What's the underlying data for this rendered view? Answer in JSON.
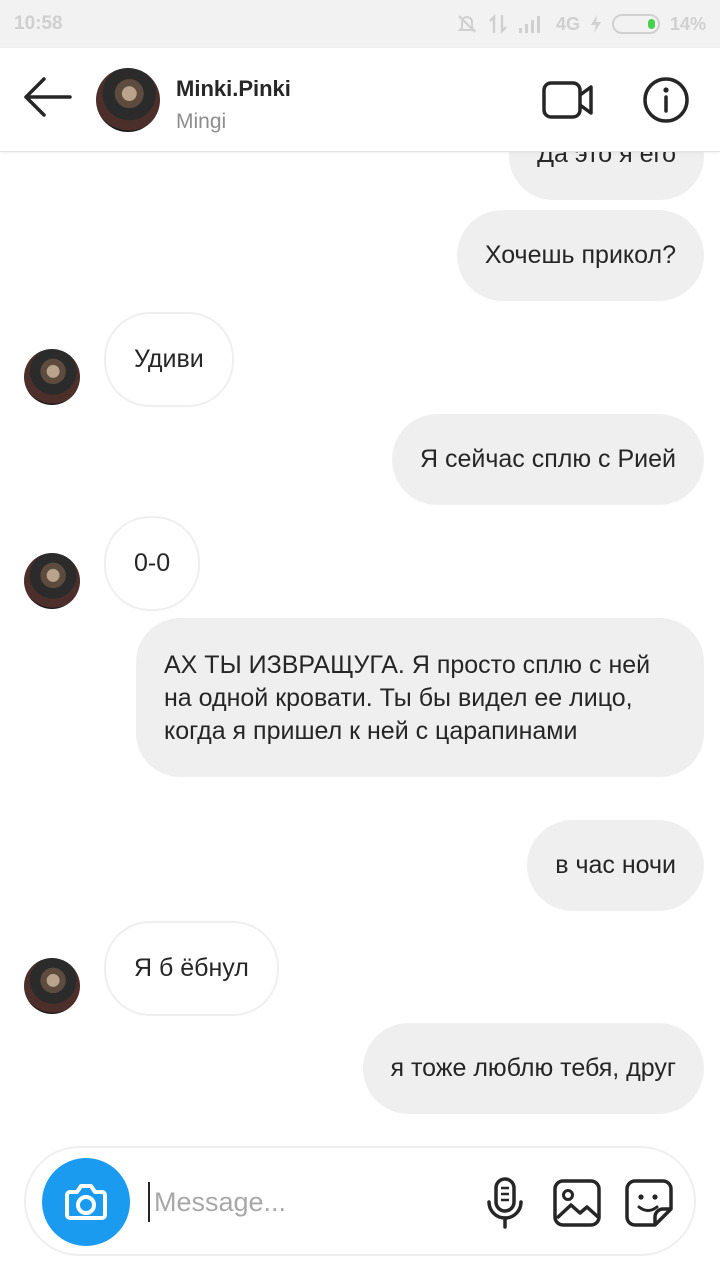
{
  "status_bar": {
    "time": "10:58",
    "network": "4G",
    "battery": "14%",
    "battery_level": 0.14
  },
  "header": {
    "title": "Minki.Pinki",
    "subtitle": "Mingi"
  },
  "messages": [
    {
      "direction": "out",
      "text": "Да это я его"
    },
    {
      "direction": "out",
      "text": "Хочешь прикол?"
    },
    {
      "direction": "in",
      "text": "Удиви"
    },
    {
      "direction": "out",
      "text": "Я сейчас сплю с Рией"
    },
    {
      "direction": "in",
      "text": "0-0"
    },
    {
      "direction": "out",
      "text": "АХ ТЫ ИЗВРАЩУГА. Я просто сплю с ней на одной кровати. Ты бы видел ее лицо, когда я пришел к ней с царапинами"
    },
    {
      "direction": "out",
      "text": "в час ночи"
    },
    {
      "direction": "in",
      "text": "Я б ёбнул"
    },
    {
      "direction": "out",
      "text": "я тоже люблю тебя, друг"
    }
  ],
  "composer": {
    "placeholder": "Message..."
  },
  "icons": {
    "back": "arrow-left-icon",
    "video": "video-camera-icon",
    "info": "info-icon",
    "camera": "camera-icon",
    "mic": "microphone-icon",
    "gallery": "image-icon",
    "sticker": "sticker-icon"
  },
  "colors": {
    "accent": "#1a9bf0",
    "bubble_out": "#efefef",
    "text_primary": "#262626",
    "text_secondary": "#8e8e8e"
  }
}
